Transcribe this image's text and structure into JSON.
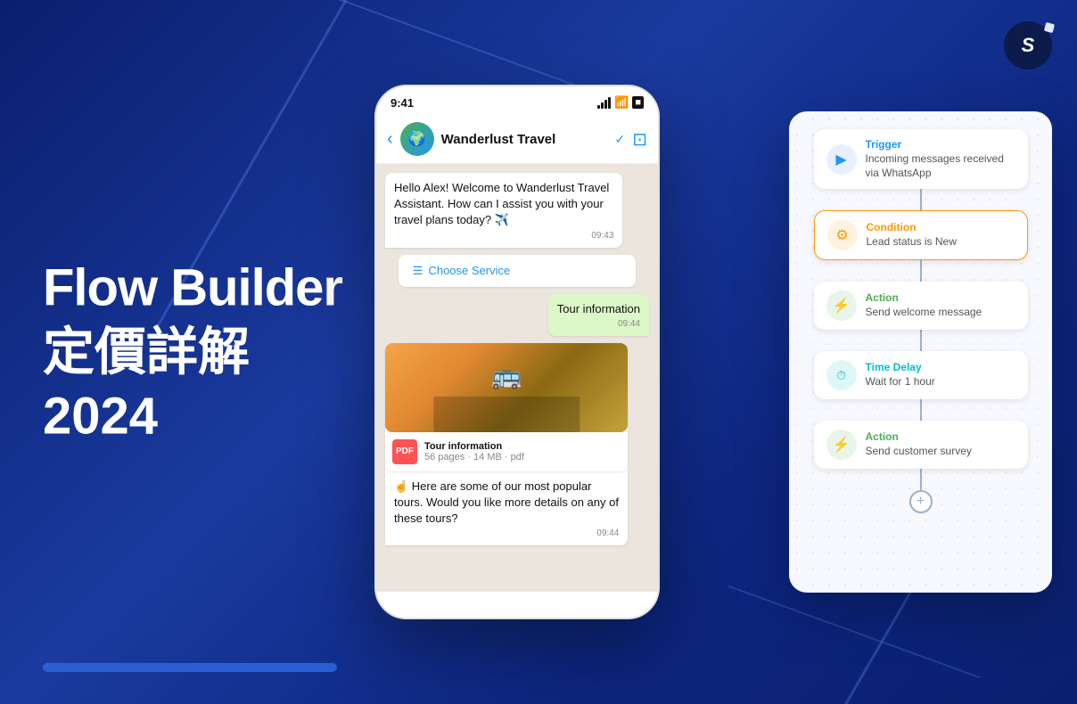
{
  "background": {
    "color_from": "#0a1f6e",
    "color_to": "#1a3a9f"
  },
  "logo": {
    "letter": "S"
  },
  "hero": {
    "title_en": "Flow Builder",
    "title_zh": "定價詳解",
    "year": "2024"
  },
  "phone": {
    "status_time": "9:41",
    "chat_name": "Wanderlust Travel",
    "messages": [
      {
        "type": "received",
        "text": "Hello Alex! Welcome to Wanderlust Travel Assistant. How can I assist you with your travel plans today? ✈️",
        "time": "09:43"
      },
      {
        "type": "button",
        "label": "Choose Service"
      },
      {
        "type": "sent",
        "text": "Tour information",
        "time": "09:44"
      },
      {
        "type": "received",
        "text": "☝️ Here are some of our most popular tours. Would you like more details on any of these tours?",
        "time": "09:44"
      }
    ],
    "pdf": {
      "title": "Tour information",
      "meta": "56 pages · 14 MB · pdf"
    }
  },
  "flow": {
    "nodes": [
      {
        "id": "trigger",
        "type_label": "Trigger",
        "type_class": "trigger",
        "description": "Incoming messages received via WhatsApp",
        "icon": "▶"
      },
      {
        "id": "condition",
        "type_label": "Condition",
        "type_class": "condition",
        "description": "Lead status is New",
        "icon": "⚙"
      },
      {
        "id": "action1",
        "type_label": "Action",
        "type_class": "action",
        "description": "Send welcome message",
        "icon": "⚡"
      },
      {
        "id": "timedelay",
        "type_label": "Time Delay",
        "type_class": "delay",
        "description": "Wait for 1 hour",
        "icon": "🕐"
      },
      {
        "id": "action2",
        "type_label": "Action",
        "type_class": "action",
        "description": "Send customer survey",
        "icon": "⚡"
      }
    ],
    "add_label": "+"
  }
}
